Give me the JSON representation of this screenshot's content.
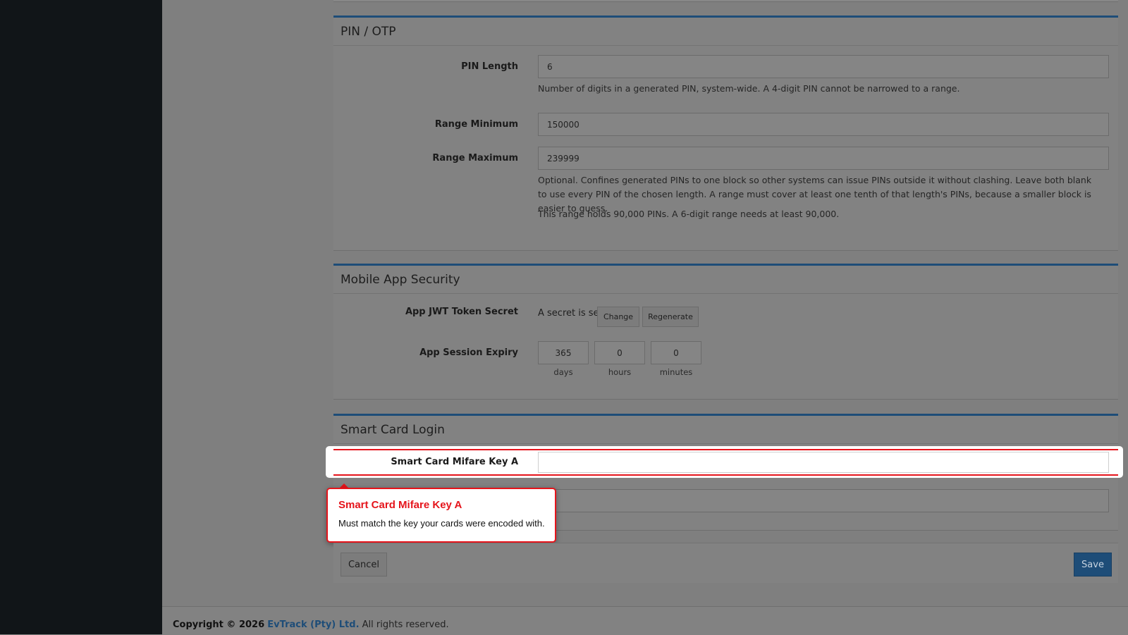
{
  "pin_otp": {
    "title": "PIN / OTP",
    "pin_length_label": "PIN Length",
    "pin_length_value": "6",
    "pin_length_help": "Number of digits in a generated PIN, system-wide. A 4-digit PIN cannot be narrowed to a range.",
    "range_min_label": "Range Minimum",
    "range_min_value": "150000",
    "range_max_label": "Range Maximum",
    "range_max_value": "239999",
    "range_help": "Optional. Confines generated PINs to one block so other systems can issue PINs outside it without clashing. Leave both blank to use every PIN of the chosen length. A range must cover at least one tenth of that length's PINs, because a smaller block is easier to guess.",
    "range_status": "This range holds 90,000 PINs. A 6-digit range needs at least 90,000."
  },
  "mobile_app": {
    "title": "Mobile App Security",
    "jwt_label": "App JWT Token Secret",
    "jwt_status": "A secret is set",
    "change_label": "Change",
    "regenerate_label": "Regenerate",
    "expiry_label": "App Session Expiry",
    "days_value": "365",
    "hours_value": "0",
    "minutes_value": "0",
    "days_unit": "days",
    "hours_unit": "hours",
    "minutes_unit": "minutes"
  },
  "smart_card": {
    "title": "Smart Card Login",
    "key_a_label": "Smart Card Mifare Key A",
    "key_a_value": ""
  },
  "tooltip": {
    "title": "Smart Card Mifare Key A",
    "text": "Must match the key your cards were encoded with."
  },
  "actions": {
    "cancel_label": "Cancel",
    "save_label": "Save"
  },
  "footer": {
    "copyright": "Copyright © 2026",
    "company": "EvTrack (Pty) Ltd.",
    "rights": "All rights reserved."
  },
  "colors": {
    "accent": "#1e4d78",
    "highlight": "#e5141b",
    "sidebar": "#111518"
  }
}
